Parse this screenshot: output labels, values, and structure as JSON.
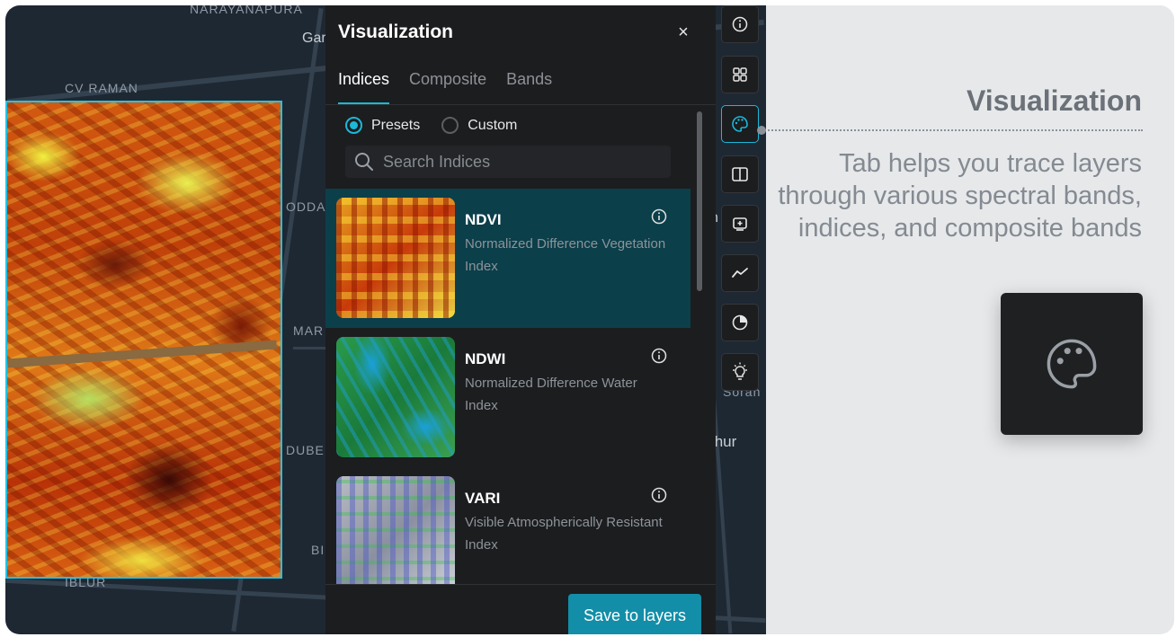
{
  "map": {
    "labels": [
      "NARAYANAPURA",
      "Gar",
      "CV RAMAN",
      "ODDA",
      "MAR",
      "DUBE",
      "BI",
      "IBLUR",
      "h",
      "thur",
      "Soran"
    ]
  },
  "panel": {
    "title": "Visualization",
    "close_label": "×",
    "tabs": [
      {
        "label": "Indices",
        "active": true
      },
      {
        "label": "Composite",
        "active": false
      },
      {
        "label": "Bands",
        "active": false
      }
    ],
    "radios": [
      {
        "label": "Presets",
        "selected": true
      },
      {
        "label": "Custom",
        "selected": false
      }
    ],
    "search": {
      "placeholder": "Search Indices"
    },
    "items": [
      {
        "name": "NDVI",
        "desc": "Normalized Difference Vegetation Index",
        "selected": true
      },
      {
        "name": "NDWI",
        "desc": "Normalized Difference Water Index",
        "selected": false
      },
      {
        "name": "VARI",
        "desc": "Visible Atmospherically Resistant Index",
        "selected": false
      }
    ],
    "save_label": "Save to layers"
  },
  "toolbar": {
    "tools": [
      "info-icon",
      "grid-icon",
      "palette-icon",
      "split-view-icon",
      "add-layer-icon",
      "chart-line-icon",
      "pie-chart-icon",
      "lightbulb-icon"
    ],
    "active": "palette-icon"
  },
  "callout": {
    "title": "Visualization",
    "text": "Tab helps you trace layers through various spectral bands, indices, and composite bands"
  },
  "colors": {
    "accent": "#1ab8d8",
    "selected_row": "#0b3f4a",
    "save_button": "#138ea8",
    "panel_bg": "#1c1d1f"
  }
}
